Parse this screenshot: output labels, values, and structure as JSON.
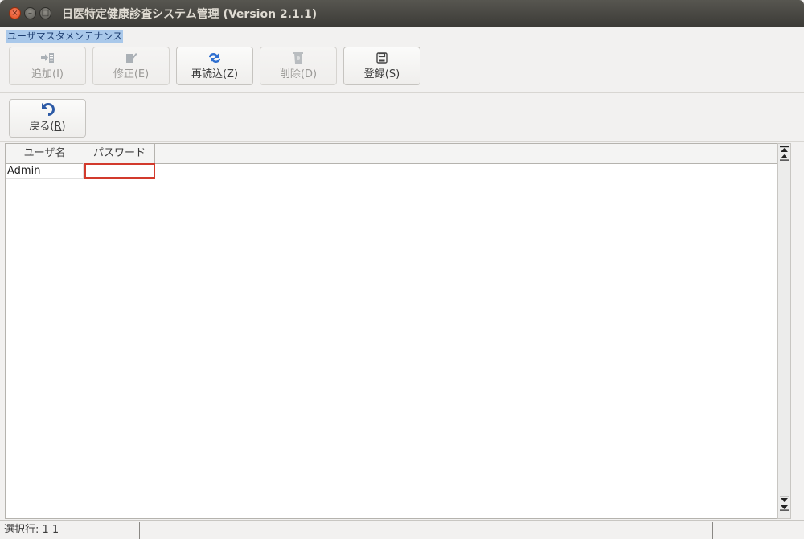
{
  "window": {
    "title": "日医特定健康診査システム管理 (Version 2.1.1)",
    "close_glyph": "×",
    "minimize_glyph": "–",
    "maximize_glyph": "□"
  },
  "subtitle": "ユーザマスタメンテナンス",
  "toolbar": {
    "add": {
      "label": "追加(I)",
      "icon": "add-row-icon",
      "enabled": false
    },
    "edit": {
      "label": "修正(E)",
      "icon": "edit-icon",
      "enabled": false
    },
    "reload": {
      "label": "再読込(Z)",
      "icon": "reload-icon",
      "enabled": true
    },
    "delete": {
      "label": "削除(D)",
      "icon": "trash-icon",
      "enabled": false
    },
    "register": {
      "label": "登録(S)",
      "icon": "save-icon",
      "enabled": true
    }
  },
  "back": {
    "label_main": "戻る(",
    "label_key": "R",
    "label_end": ")",
    "icon": "undo-arrow-icon"
  },
  "table": {
    "columns": [
      "ユーザ名",
      "パスワード"
    ],
    "rows": [
      {
        "username": "Admin",
        "password": ""
      }
    ]
  },
  "status": {
    "selected_row": "選択行: 1  1"
  },
  "colors": {
    "titlebar": "#3c3b37",
    "close_button": "#df4a16",
    "selection_highlight": "#a9c8ea",
    "edit_cell_border": "#d23a2c",
    "reload_icon": "#2f6fd0"
  }
}
